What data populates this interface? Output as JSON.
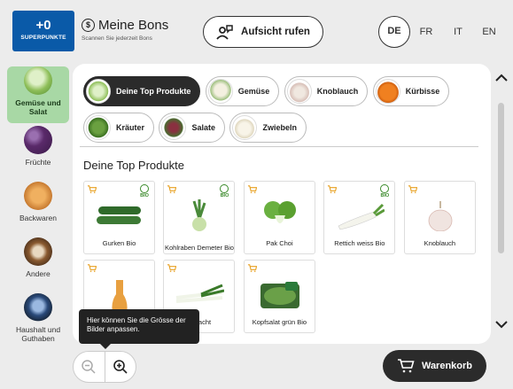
{
  "header": {
    "superpunkte": {
      "points": "+0",
      "label": "SUPERPUNKTE"
    },
    "bons": {
      "title": "Meine Bons",
      "subtitle": "Scannen Sie jederzeit Bons"
    },
    "aufsicht_label": "Aufsicht rufen",
    "languages": [
      "DE",
      "FR",
      "IT",
      "EN"
    ],
    "active_language": "DE"
  },
  "sidebar": {
    "items": [
      {
        "label": "Gemüse und Salat",
        "icon": "cabbage-icon",
        "active": true
      },
      {
        "label": "Früchte",
        "icon": "grapes-icon"
      },
      {
        "label": "Backwaren",
        "icon": "croissant-icon"
      },
      {
        "label": "Andere",
        "icon": "nuts-icon"
      },
      {
        "label": "Haushalt und Guthaben",
        "icon": "bags-icon"
      }
    ]
  },
  "filters": [
    {
      "label": "Deine Top Produkte",
      "active": true
    },
    {
      "label": "Gemüse"
    },
    {
      "label": "Knoblauch"
    },
    {
      "label": "Kürbisse"
    },
    {
      "label": "Kräuter"
    },
    {
      "label": "Salate"
    },
    {
      "label": "Zwiebeln"
    }
  ],
  "section_title": "Deine Top Produkte",
  "products": [
    {
      "name": "Gurken Bio",
      "bio": true
    },
    {
      "name": "Kohlraben Demeter Bio",
      "bio": true
    },
    {
      "name": "Pak Choi",
      "bio": false
    },
    {
      "name": "Rettich weiss Bio",
      "bio": true
    },
    {
      "name": "Knoblauch",
      "bio": false
    },
    {
      "name": "",
      "bio": false
    },
    {
      "name": "asnacht",
      "bio": false
    },
    {
      "name": "Kopfsalat grün Bio",
      "bio": false
    }
  ],
  "bio_label": "BIO",
  "tooltip": "Hier können Sie die Grösse der Bilder anpassen.",
  "cart_label": "Warenkorb",
  "colors": {
    "brand_blue": "#0a5aa8",
    "active_green": "#a8d8a5",
    "dark": "#2b2b2b",
    "bio_green": "#3a8a2a"
  }
}
